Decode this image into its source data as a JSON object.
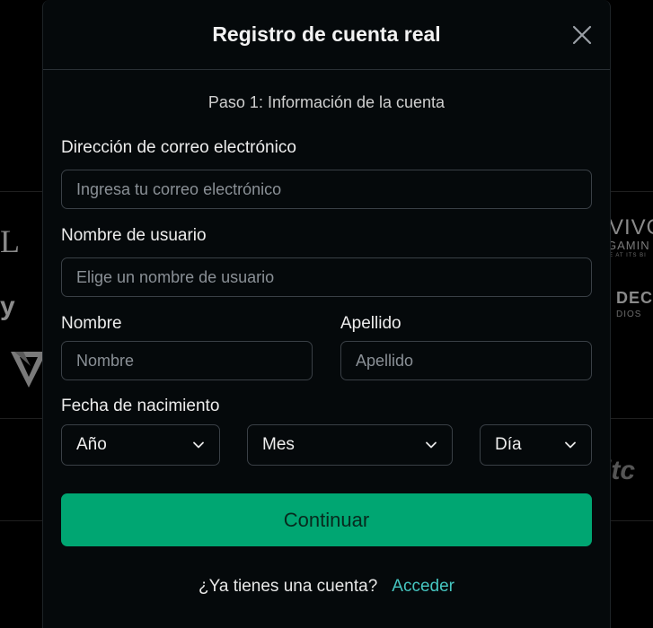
{
  "modal": {
    "title": "Registro de cuenta real",
    "step": "Paso 1: Información de la cuenta"
  },
  "form": {
    "email": {
      "label": "Dirección de correo electrónico",
      "placeholder": "Ingresa tu correo electrónico",
      "value": ""
    },
    "username": {
      "label": "Nombre de usuario",
      "placeholder": "Elige un nombre de usuario",
      "value": ""
    },
    "first_name": {
      "label": "Nombre",
      "placeholder": "Nombre",
      "value": ""
    },
    "last_name": {
      "label": "Apellido",
      "placeholder": "Apellido",
      "value": ""
    },
    "birthdate": {
      "label": "Fecha de nacimiento",
      "year": "Año",
      "month": "Mes",
      "day": "Día"
    },
    "continue_label": "Continuar"
  },
  "footer": {
    "question": "¿Ya tienes una cuenta?",
    "link": "Acceder"
  },
  "background_logos": {
    "left_letter": "L",
    "left_y": "y",
    "right_vivo": "VIVO",
    "right_gaming": "GAMIN",
    "right_tagline": "E AT ITS BI",
    "right_dec": "DEC",
    "right_dios": "DIOS",
    "right_itc": "itc"
  },
  "colors": {
    "accent": "#00a672",
    "link": "#46c6c1",
    "modal_bg": "#05090b"
  }
}
